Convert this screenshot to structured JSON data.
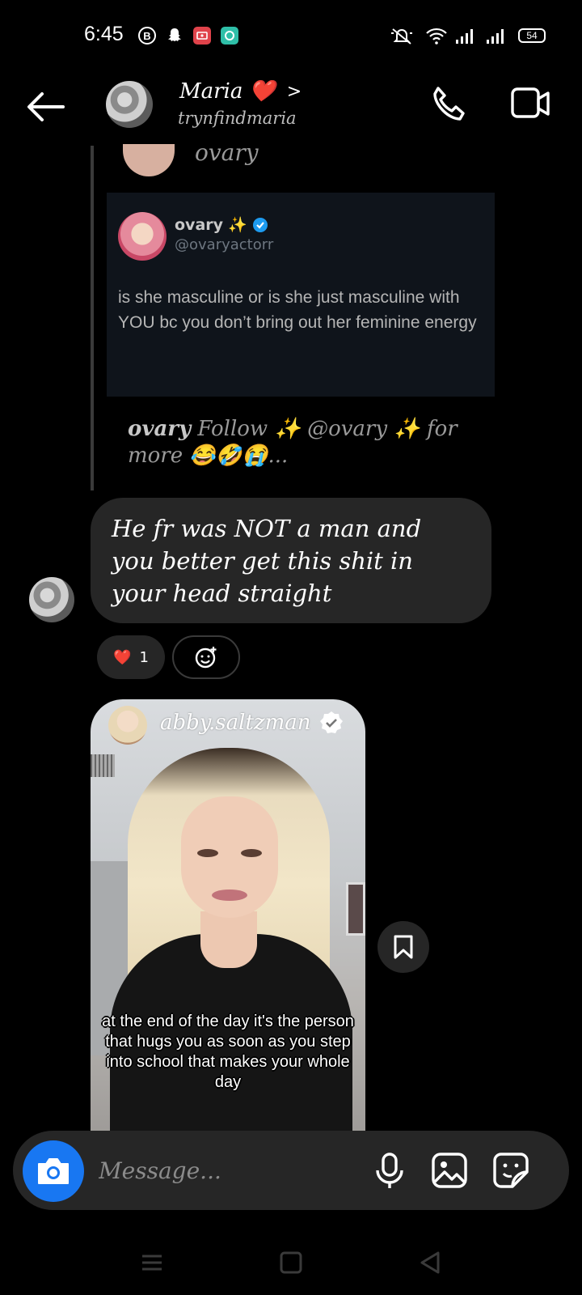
{
  "status_bar": {
    "time": "6:45",
    "battery": "54",
    "icons": [
      "b-circle-icon",
      "snapchat-icon",
      "screen-record-icon",
      "app-icon",
      "mute-icon",
      "wifi-icon",
      "signal-icon",
      "signal-icon"
    ]
  },
  "header": {
    "name": "Maria",
    "heart": "❤️",
    "chevron": ">",
    "username": "trynfindmaria"
  },
  "shared_post": {
    "top_name": "ovary",
    "tweet": {
      "name": "ovary",
      "sparkle": "✨",
      "handle": "@ovaryactorr",
      "text": "is she masculine or is she just masculine with YOU bc you don’t bring out her feminine energy"
    },
    "caption_user": "ovary",
    "caption_text": "Follow ✨ @ovary ✨ for more 😂🤣😭..."
  },
  "message": {
    "text": "He fr was NOT a man and you better get this shit in your head straight",
    "reaction_emoji": "❤️",
    "reaction_count": "1"
  },
  "reel": {
    "username": "abby.saltzman",
    "subtitle": "at the end of the day it's the person that hugs you as soon as you step into school that makes your whole day"
  },
  "composer": {
    "placeholder": "Message..."
  },
  "colors": {
    "accent": "#1877f2",
    "bubble": "#262626",
    "background": "#000000",
    "tweet_bg": "#0f141b",
    "heart": "#e0245e"
  }
}
